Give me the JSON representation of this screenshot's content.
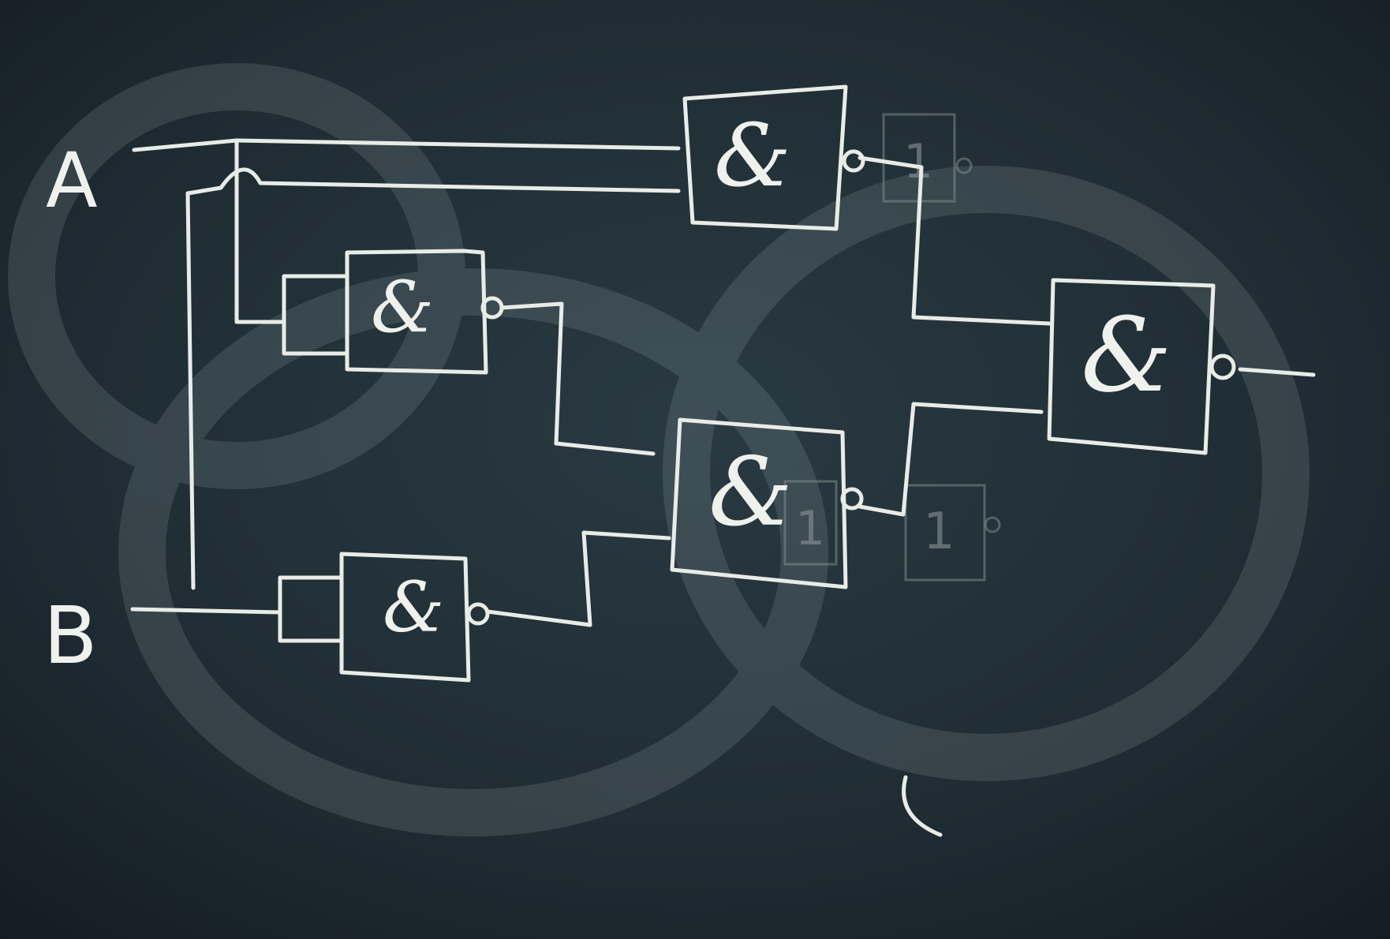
{
  "inputs": {
    "a": "A",
    "b": "B"
  },
  "gates": {
    "g1": "&",
    "g2": "&",
    "g3": "&",
    "g4": "&",
    "g5": "&"
  },
  "erased_marks": {
    "m1": "1",
    "m2": "1",
    "m3": "1"
  },
  "colors": {
    "board": "#1f2c33",
    "chalk": "#e8ece6"
  }
}
